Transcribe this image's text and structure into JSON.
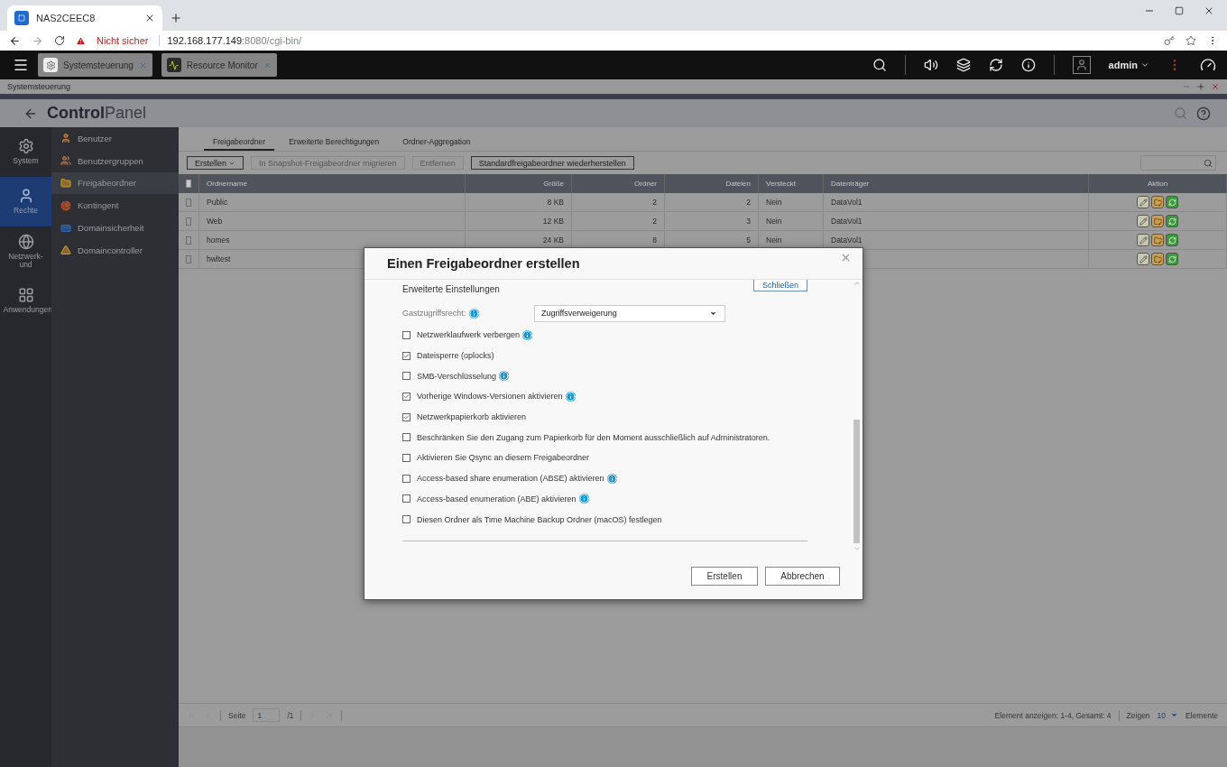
{
  "browser": {
    "tab_title": "NAS2CEEC8",
    "warning": "Nicht sicher",
    "url_host": "192.168.177.149",
    "url_rest": ":8080/cgi-bin/"
  },
  "app_tabs": [
    {
      "label": "Systemsteuerung"
    },
    {
      "label": "Resource Monitor"
    }
  ],
  "user": "admin",
  "window_title": "Systemsteuerung",
  "app_title": "**Control**Panel",
  "rail": [
    {
      "label": "System",
      "selected": false
    },
    {
      "label": "Rechte",
      "selected": true
    },
    {
      "label": "Netzwerk- und",
      "selected": false
    },
    {
      "label": "Anwendungen",
      "selected": false
    }
  ],
  "nav": [
    {
      "label": "Benutzer",
      "selected": false
    },
    {
      "label": "Benutzergruppen",
      "selected": false
    },
    {
      "label": "Freigabeordner",
      "selected": true
    },
    {
      "label": "Kontingent",
      "selected": false
    },
    {
      "label": "Domainsicherheit",
      "selected": false
    },
    {
      "label": "Domaincontroller",
      "selected": false
    }
  ],
  "tabs": [
    {
      "label": "Freigabeordner",
      "selected": true
    },
    {
      "label": "Erweiterte Berechtigungen",
      "selected": false
    },
    {
      "label": "Ordner-Aggregation",
      "selected": false
    }
  ],
  "toolbar": [
    {
      "label": "Erstellen",
      "kind": "dropdown",
      "disabled": false
    },
    {
      "label": "In Snapshot-Freigabeordner migrieren",
      "kind": "button",
      "disabled": true
    },
    {
      "label": "Entfernen",
      "kind": "button",
      "disabled": true
    },
    {
      "label": "Standardfreigabeordner wiederherstellen",
      "kind": "button",
      "disabled": false
    }
  ],
  "table": {
    "select_all_checked": false,
    "columns": [
      "Ordnername",
      "Größe",
      "Ordner",
      "Dateien",
      "Versteckt",
      "Datenträger",
      "Aktion"
    ],
    "rows": [
      {
        "checked": false,
        "cells": [
          "Public",
          "8 KB",
          "2",
          "2",
          "Nein",
          "DataVol1"
        ]
      },
      {
        "checked": false,
        "cells": [
          "Web",
          "12 KB",
          "2",
          "3",
          "Nein",
          "DataVol1"
        ]
      },
      {
        "checked": false,
        "cells": [
          "homes",
          "24 KB",
          "8",
          "5",
          "Nein",
          "DataVol1"
        ]
      },
      {
        "checked": false,
        "cells": [
          "hwltest"
        ]
      }
    ]
  },
  "footer": {
    "page_label": "Seite",
    "page": "1",
    "page_total": "/1",
    "summary": "Element anzeigen: 1-4, Gesamt: 4",
    "show_label": "Zeigen",
    "per_page": "10",
    "unit": "Elemente"
  },
  "dialog": {
    "title": "Einen Freigabeordner erstellen",
    "section": "Erweiterte Einstellungen",
    "collapse_button": "Schließen",
    "guest_label": "Gastzugriffsrecht:",
    "guest_value": "Zugriffsverweigerung",
    "options": [
      {
        "label": "Netzwerklaufwerk verbergen",
        "checked": false,
        "info": true
      },
      {
        "label": "Dateisperre (oplocks)",
        "checked": true,
        "info": false
      },
      {
        "label": "SMB-Verschlüsselung",
        "checked": false,
        "info": true
      },
      {
        "label": "Vorherige Windows-Versionen aktivieren",
        "checked": true,
        "info": true
      },
      {
        "label": "Netzwerkpapierkorb aktivieren",
        "checked": true,
        "info": false
      },
      {
        "label": "Beschränken Sie den Zugang zum Papierkorb für den Moment ausschließlich auf Administratoren.",
        "checked": false,
        "info": false
      },
      {
        "label": "Aktivieren Sie Qsync an diesem Freigabeordner",
        "checked": false,
        "info": false
      },
      {
        "label": "Access-based share enumeration (ABSE) aktivieren",
        "checked": false,
        "info": true
      },
      {
        "label": "Access-based enumeration (ABE) aktivieren",
        "checked": false,
        "info": true
      },
      {
        "label": "Diesen Ordner als Time Machine Backup Ordner (macOS) festlegen",
        "checked": false,
        "info": false
      }
    ],
    "buttons": [
      "Erstellen",
      "Abbrechen"
    ]
  }
}
